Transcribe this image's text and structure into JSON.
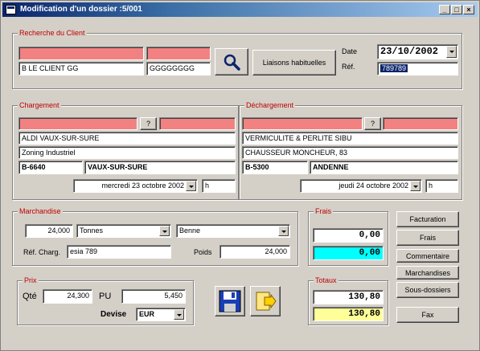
{
  "window": {
    "title": "Modification d'un dossier :5/001"
  },
  "client": {
    "legend": "Recherche du Client",
    "name": "B LE CLIENT GG",
    "code": "GGGGGGGG",
    "liaisons_label": "Liaisons habituelles",
    "date_label": "Date",
    "date_value": "23/10/2002",
    "ref_label": "Réf.",
    "ref_value": "789789"
  },
  "chargement": {
    "legend": "Chargement",
    "help_label": "?",
    "line1": "ALDI VAUX-SUR-SURE",
    "line2": "Zoning Industriel",
    "postal": "B-6640",
    "city": "VAUX-SUR-SURE",
    "date_text": "mercredi 23 octobre 2002",
    "hour": "h"
  },
  "dechargement": {
    "legend": "Déchargement",
    "help_label": "?",
    "line1": "VERMICULITE & PERLITE SIBU",
    "line2": "CHAUSSEUR MONCHEUR, 83",
    "postal": "B-5300",
    "city": "ANDENNE",
    "date_text": "jeudi 24 octobre 2002",
    "hour": "h"
  },
  "marchandise": {
    "legend": "Marchandise",
    "quantity": "24,000",
    "unit": "Tonnes",
    "vehicle": "Benne",
    "ref_charg_label": "Réf. Charg.",
    "ref_charg_value": "esia 789",
    "poids_label": "Poids",
    "poids_value": "24,000"
  },
  "frais": {
    "legend": "Frais",
    "value1": "0,00",
    "value2": "0,00"
  },
  "prix": {
    "legend": "Prix",
    "qte_label": "Qté",
    "qte_value": "24,300",
    "pu_label": "PU",
    "pu_value": "5,450",
    "devise_label": "Devise",
    "devise_value": "EUR"
  },
  "totaux": {
    "legend": "Totaux",
    "value1": "130,80",
    "value2": "130,80"
  },
  "side_buttons": {
    "facturation": "Facturation",
    "frais": "Frais",
    "commentaire": "Commentaire",
    "marchandises": "Marchandises",
    "sous_dossiers": "Sous-dossiers",
    "fax": "Fax"
  },
  "colors": {
    "required_field": "#f28282",
    "title_start": "#0a246a",
    "title_end": "#a6caf0",
    "frais_highlight": "#00ffff",
    "total_highlight": "#ffff99"
  }
}
